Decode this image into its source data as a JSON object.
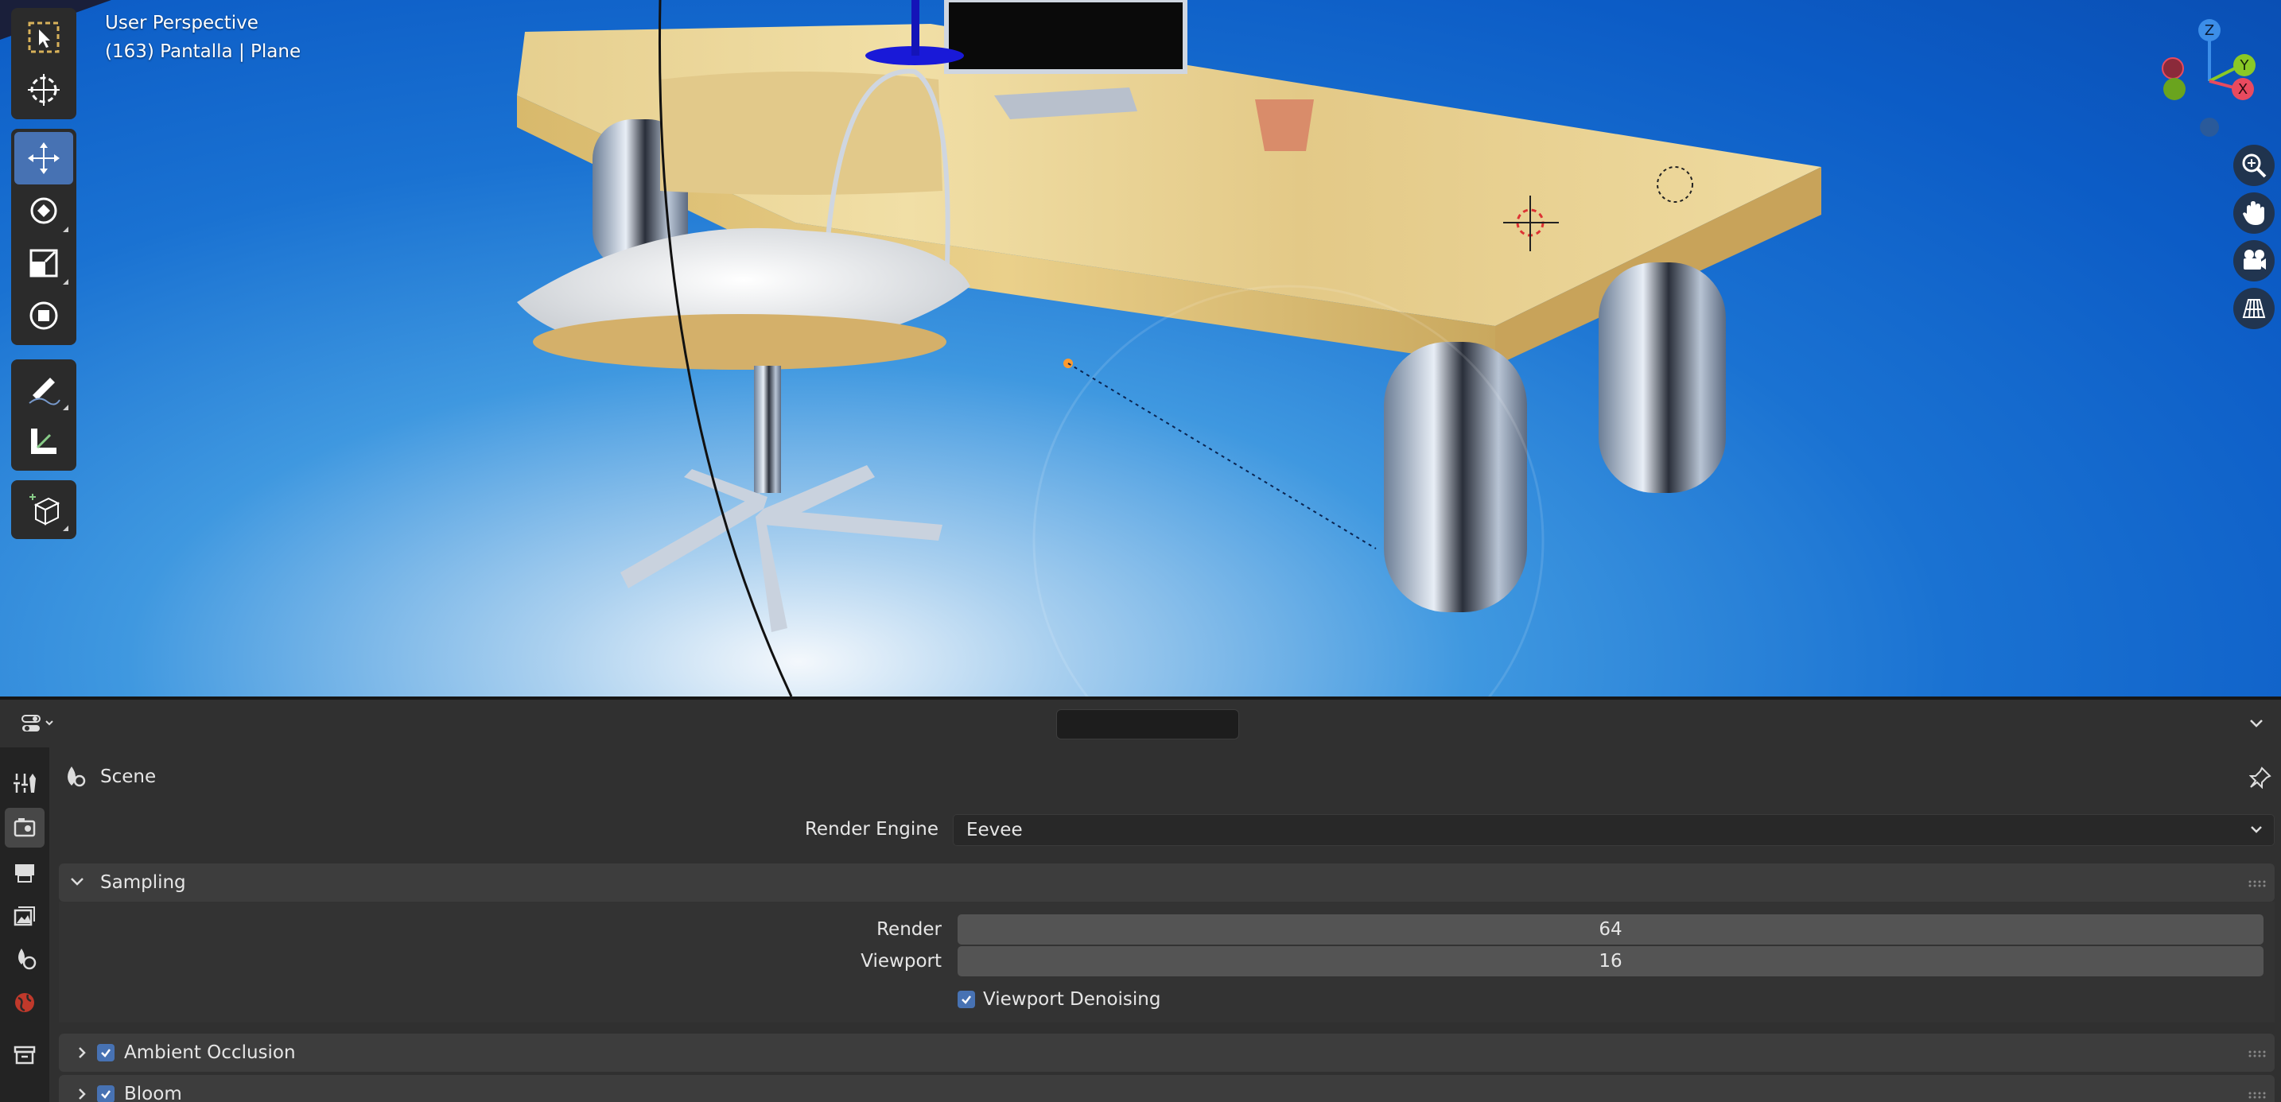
{
  "viewport": {
    "view_name": "User Perspective",
    "object_info": "(163) Pantalla | Plane",
    "gizmo": {
      "z": "Z",
      "y": "Y",
      "x": "X"
    }
  },
  "toolbar": {
    "tools": [
      {
        "name": "select-box-tool",
        "icon": "select-box-icon",
        "active": false
      },
      {
        "name": "cursor-tool",
        "icon": "cursor-icon",
        "active": false
      },
      {
        "name": "move-tool",
        "icon": "move-icon",
        "active": true
      },
      {
        "name": "rotate-tool",
        "icon": "rotate-icon",
        "active": false
      },
      {
        "name": "scale-tool",
        "icon": "scale-icon",
        "active": false
      },
      {
        "name": "transform-tool",
        "icon": "transform-icon",
        "active": false
      },
      {
        "name": "annotate-tool",
        "icon": "annotate-icon",
        "active": false
      },
      {
        "name": "measure-tool",
        "icon": "measure-icon",
        "active": false
      },
      {
        "name": "add-cube-tool",
        "icon": "add-cube-icon",
        "active": false
      }
    ]
  },
  "navigation": [
    "zoom-icon",
    "hand-icon",
    "camera-icon",
    "grid-view-icon"
  ],
  "properties": {
    "search_placeholder": "",
    "context_label": "Scene",
    "render_engine_label": "Render Engine",
    "render_engine_value": "Eevee",
    "sampling": {
      "title": "Sampling",
      "render_label": "Render",
      "render_value": "64",
      "viewport_label": "Viewport",
      "viewport_value": "16",
      "denoise_label": "Viewport Denoising",
      "denoise_checked": true
    },
    "panels": [
      {
        "title": "Ambient Occlusion",
        "checked": true
      },
      {
        "title": "Bloom",
        "checked": true
      }
    ],
    "tabs": [
      "tool-icon",
      "render-icon",
      "output-icon",
      "view-layer-icon",
      "scene-icon",
      "world-icon",
      "collection-icon"
    ]
  },
  "colors": {
    "accent": "#4772b3",
    "axis_x": "#e84a5f",
    "axis_y": "#8ac926",
    "axis_z": "#3c8ee8"
  }
}
